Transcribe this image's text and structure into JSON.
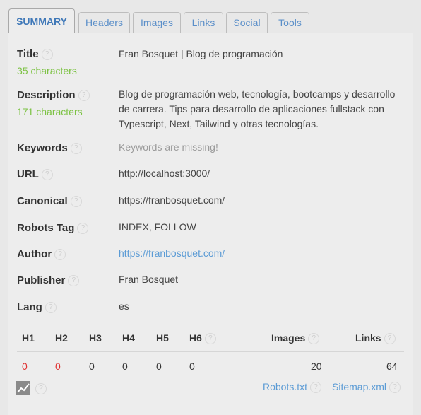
{
  "tabs": [
    "SUMMARY",
    "Headers",
    "Images",
    "Links",
    "Social",
    "Tools"
  ],
  "help_glyph": "?",
  "fields": {
    "title": {
      "label": "Title",
      "count": "35 characters",
      "value": "Fran Bosquet | Blog de programación"
    },
    "description": {
      "label": "Description",
      "count": "171 characters",
      "lines": [
        "Blog de programación web, tecnología, bootcamps y desarrollo",
        "de carrera. Tips para desarrollo de aplicaciones fullstack con",
        "Typescript, Next, Tailwind y otras tecnologías."
      ]
    },
    "keywords": {
      "label": "Keywords",
      "value": "Keywords are missing!"
    },
    "url": {
      "label": "URL",
      "value": "http://localhost:3000/"
    },
    "canonical": {
      "label": "Canonical",
      "value": "https://franbosquet.com/"
    },
    "robots": {
      "label": "Robots Tag",
      "value": "INDEX, FOLLOW"
    },
    "author": {
      "label": "Author",
      "value": "https://franbosquet.com/"
    },
    "publisher": {
      "label": "Publisher",
      "value": "Fran Bosquet"
    },
    "lang": {
      "label": "Lang",
      "value": "es"
    }
  },
  "stats": {
    "headers": [
      "H1",
      "H2",
      "H3",
      "H4",
      "H5",
      "H6"
    ],
    "header_values": [
      "0",
      "0",
      "0",
      "0",
      "0",
      "0"
    ],
    "images_label": "Images",
    "images_value": "20",
    "links_label": "Links",
    "links_value": "64"
  },
  "footer": {
    "robots_link": "Robots.txt",
    "sitemap_link": "Sitemap.xml"
  },
  "colors": {
    "accent": "#3f78b8",
    "count_green": "#7cc243",
    "link": "#5b9bd5",
    "zero_red": "#e03030"
  }
}
